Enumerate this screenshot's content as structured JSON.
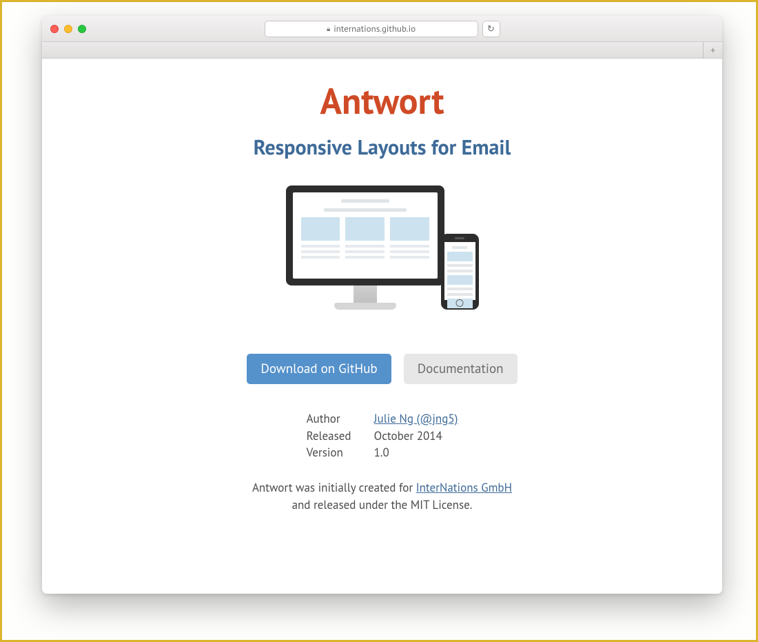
{
  "browser": {
    "url_host": "internations.github.io",
    "new_tab_glyph": "+",
    "reload_glyph": "↻"
  },
  "page": {
    "title": "Antwort",
    "tagline": "Responsive Layouts for Email",
    "buttons": {
      "download": "Download on GitHub",
      "docs": "Documentation"
    },
    "meta": {
      "author_label": "Author",
      "author_value": "Julie Ng (@jng5)",
      "released_label": "Released",
      "released_value": "October 2014",
      "version_label": "Version",
      "version_value": "1.0"
    },
    "footer": {
      "prefix": "Antwort was initially created for ",
      "company": "InterNations GmbH",
      "suffix": "and released under the MIT License."
    }
  }
}
